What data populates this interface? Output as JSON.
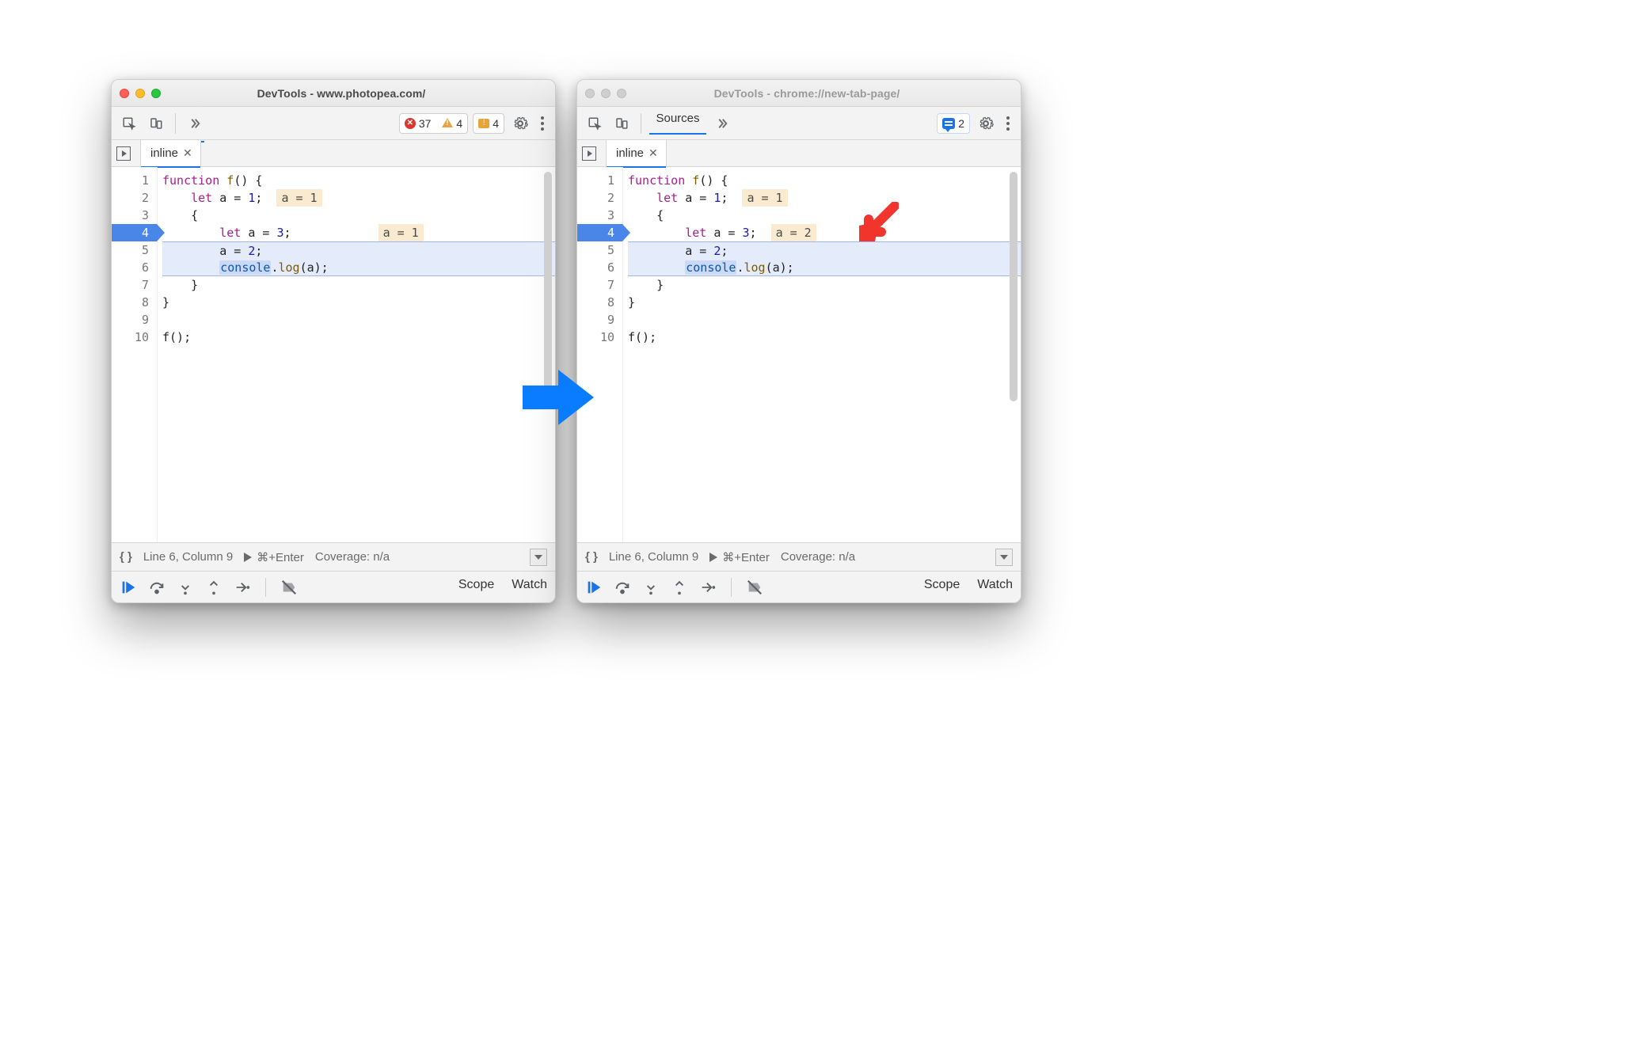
{
  "left": {
    "title": "DevTools - www.photopea.com/",
    "active": true,
    "toolbar": {
      "errors": "37",
      "warnings": "4",
      "messages": "4"
    },
    "file_tab": "inline",
    "code": {
      "lines": [
        "1",
        "2",
        "3",
        "4",
        "5",
        "6",
        "7",
        "8",
        "9",
        "10"
      ],
      "exec_line": 4,
      "badge2": "a = 1",
      "badge4": "a = 1",
      "src": {
        "l1a": "function",
        "l1b": " f",
        "l1c": "() {",
        "l2a": "    ",
        "l2b": "let",
        "l2c": " a = ",
        "l2d": "1",
        "l2e": ";",
        "l3": "    {",
        "l4a": "        ",
        "l4b": "let",
        "l4c": " a = ",
        "l4d": "3",
        "l4e": ";",
        "l5a": "        a = ",
        "l5b": "2",
        "l5c": ";",
        "l6a": "        ",
        "l6b": "console",
        "l6c": ".",
        "l6d": "log",
        "l6e": "(a);",
        "l7": "    }",
        "l8": "}",
        "l9": "",
        "l10": "f();"
      }
    },
    "status": {
      "pos": "Line 6, Column 9",
      "run": "⌘+Enter",
      "cov": "Coverage: n/a"
    },
    "debug_tabs": {
      "scope": "Scope",
      "watch": "Watch"
    }
  },
  "right": {
    "title": "DevTools - chrome://new-tab-page/",
    "active": false,
    "toolbar": {
      "panel": "Sources",
      "issues": "2"
    },
    "file_tab": "inline",
    "code": {
      "lines": [
        "1",
        "2",
        "3",
        "4",
        "5",
        "6",
        "7",
        "8",
        "9",
        "10"
      ],
      "exec_line": 4,
      "badge2": "a = 1",
      "badge4": "a = 2",
      "src": {
        "l1a": "function",
        "l1b": " f",
        "l1c": "() {",
        "l2a": "    ",
        "l2b": "let",
        "l2c": " a = ",
        "l2d": "1",
        "l2e": ";",
        "l3": "    {",
        "l4a": "        ",
        "l4b": "let",
        "l4c": " a = ",
        "l4d": "3",
        "l4e": ";",
        "l5a": "        a = ",
        "l5b": "2",
        "l5c": ";",
        "l6a": "        ",
        "l6b": "console",
        "l6c": ".",
        "l6d": "log",
        "l6e": "(a);",
        "l7": "    }",
        "l8": "}",
        "l9": "",
        "l10": "f();"
      }
    },
    "status": {
      "pos": "Line 6, Column 9",
      "run": "⌘+Enter",
      "cov": "Coverage: n/a"
    },
    "debug_tabs": {
      "scope": "Scope",
      "watch": "Watch"
    }
  }
}
